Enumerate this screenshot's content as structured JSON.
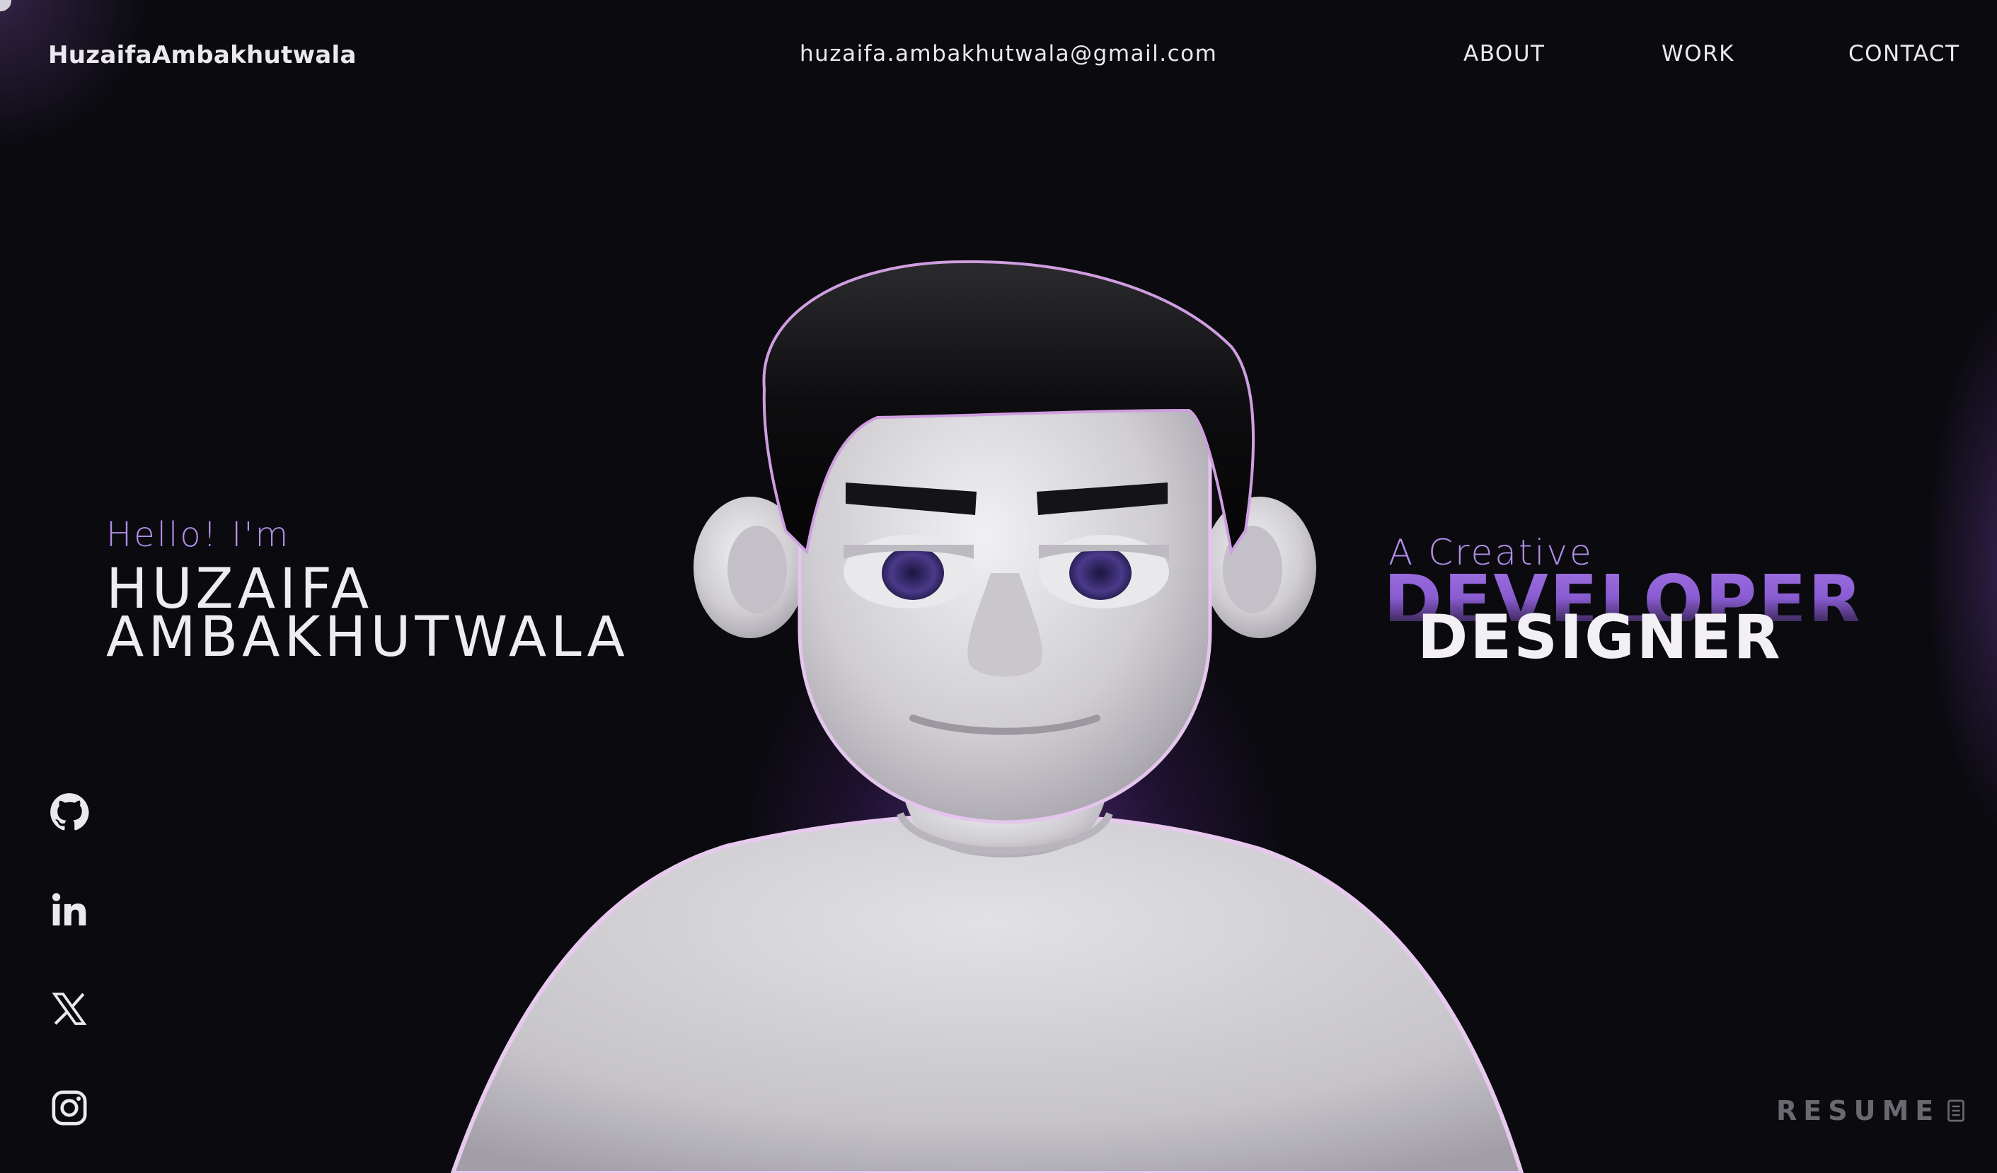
{
  "header": {
    "logo": "HuzaifaAmbakhutwala",
    "email": "huzaifa.ambakhutwala@gmail.com",
    "nav": [
      {
        "label": "ABOUT"
      },
      {
        "label": "WORK"
      },
      {
        "label": "CONTACT"
      }
    ]
  },
  "intro": {
    "greeting": "Hello! I'm",
    "first_name": "HUZAIFA",
    "last_name": "AMBAKHUTWALA"
  },
  "role": {
    "prefix": "A Creative",
    "title_back": "DEVELOPER",
    "title_front": "DESIGNER"
  },
  "social": [
    {
      "icon": "github-icon"
    },
    {
      "icon": "linkedin-icon"
    },
    {
      "icon": "x-twitter-icon"
    },
    {
      "icon": "instagram-icon"
    }
  ],
  "resume": {
    "label": "RESUME",
    "icon": "document-icon"
  },
  "colors": {
    "background": "#0b0a0f",
    "accent_purple": "#b08ee8",
    "text": "#ece8ef",
    "muted": "#6b6870"
  }
}
